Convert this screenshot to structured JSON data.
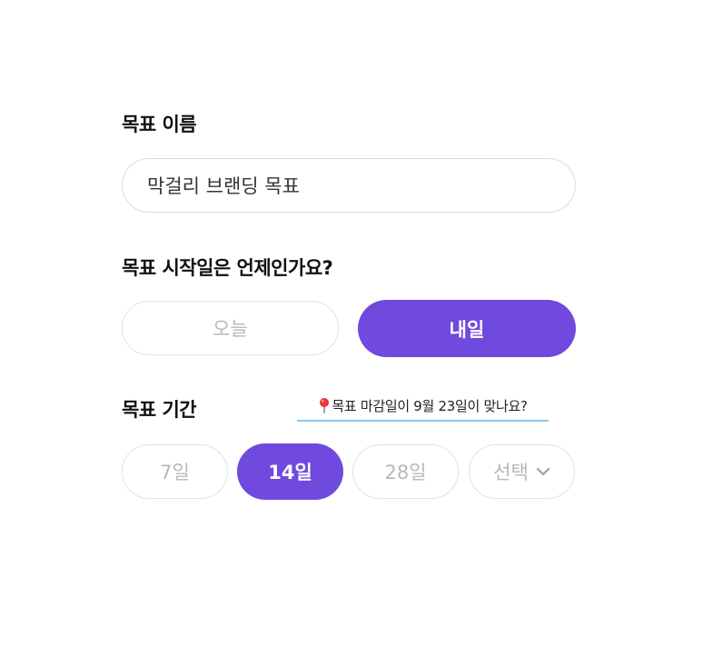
{
  "colors": {
    "accent": "#7049df",
    "hint_underline": "#8dc9ec",
    "pill_border": "#e3e3e3",
    "inactive_text": "#b8b8b8"
  },
  "goal_name": {
    "label": "목표 이름",
    "value": "막걸리 브랜딩 목표"
  },
  "start_date": {
    "label": "목표 시작일은 언제인가요?",
    "options": [
      {
        "label": "오늘",
        "selected": false
      },
      {
        "label": "내일",
        "selected": true
      }
    ]
  },
  "duration": {
    "label": "목표 기간",
    "hint": "목표 마감일이 9월 23일이 맞나요?",
    "hint_icon": "pin-icon",
    "options": [
      {
        "label": "7일",
        "selected": false
      },
      {
        "label": "14일",
        "selected": true
      },
      {
        "label": "28일",
        "selected": false
      },
      {
        "label": "선택",
        "selected": false,
        "icon": "chevron-down-icon"
      }
    ]
  }
}
